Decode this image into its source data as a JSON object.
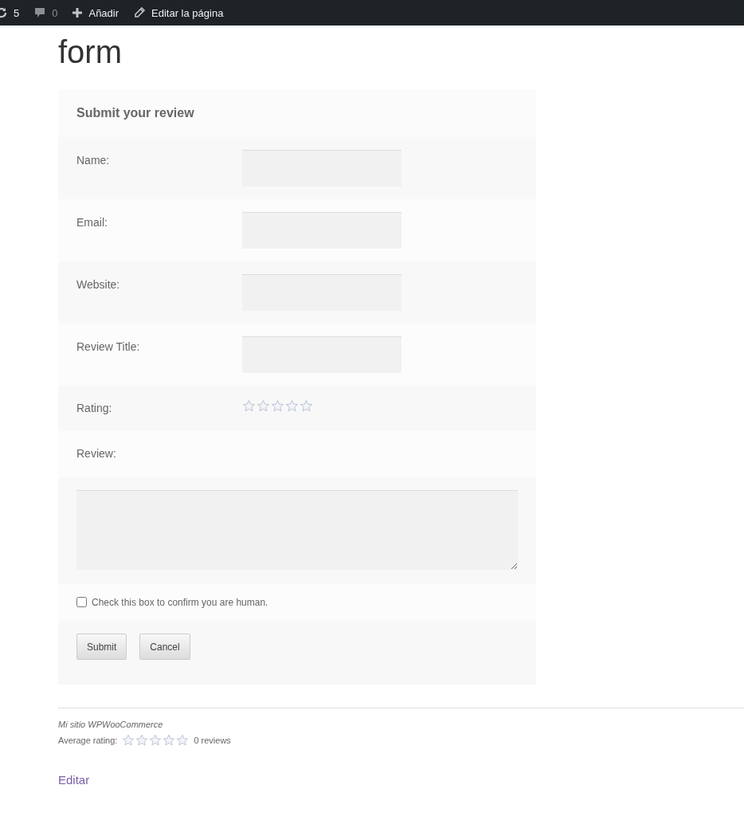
{
  "admin_bar": {
    "updates": "5",
    "comments": "0",
    "add": "Añadir",
    "edit_page": "Editar la página"
  },
  "page_title": "form",
  "review_form": {
    "heading": "Submit your review",
    "fields": [
      {
        "kind": "text",
        "label": "Name:"
      },
      {
        "kind": "text",
        "label": "Email:"
      },
      {
        "kind": "text",
        "label": "Website:"
      },
      {
        "kind": "text",
        "label": "Review Title:"
      },
      {
        "kind": "rating",
        "label": "Rating:",
        "stars": 0
      },
      {
        "kind": "textarea",
        "label": "Review:"
      }
    ],
    "human_check": {
      "label": "Check this box to confirm you are human.",
      "checked": false
    },
    "buttons": [
      "Submit",
      "Cancel"
    ]
  },
  "footer": {
    "site_name": "Mi sitio WPWooCommerce",
    "average_rating": {
      "label": "Average rating:",
      "stars": 0
    },
    "review_count": "0 reviews",
    "edit_link": "Editar"
  }
}
